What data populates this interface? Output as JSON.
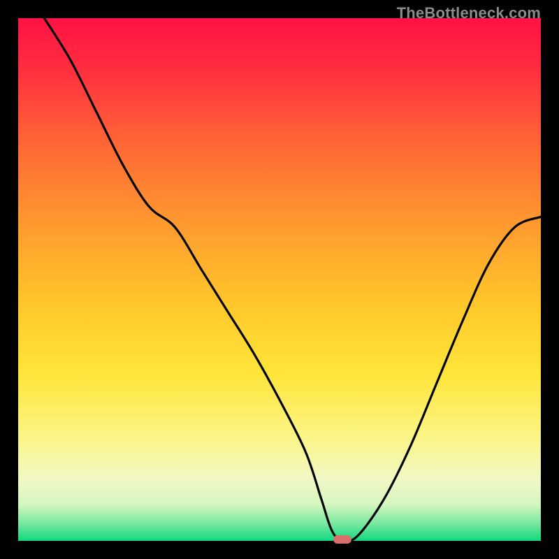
{
  "watermark": "TheBottleneck.com",
  "chart_data": {
    "type": "line",
    "title": "",
    "xlabel": "",
    "ylabel": "",
    "xlim": [
      0,
      100
    ],
    "ylim": [
      0,
      100
    ],
    "x": [
      5,
      10,
      15,
      20,
      25,
      30,
      35,
      40,
      45,
      50,
      55,
      58,
      60,
      62,
      65,
      70,
      75,
      80,
      85,
      90,
      95,
      100
    ],
    "values": [
      100,
      92,
      82,
      72,
      64,
      60,
      52,
      44,
      36,
      27,
      17,
      8,
      2,
      0,
      1,
      8,
      18,
      30,
      42,
      53,
      60,
      62
    ],
    "minimum_x": 62,
    "gradient_stops": [
      {
        "pos": 0.0,
        "color": "#ff1244"
      },
      {
        "pos": 0.1,
        "color": "#ff2f3f"
      },
      {
        "pos": 0.25,
        "color": "#ff6a35"
      },
      {
        "pos": 0.4,
        "color": "#ff9c2f"
      },
      {
        "pos": 0.55,
        "color": "#ffc82a"
      },
      {
        "pos": 0.68,
        "color": "#ffe53a"
      },
      {
        "pos": 0.8,
        "color": "#fbf585"
      },
      {
        "pos": 0.88,
        "color": "#f2f8c4"
      },
      {
        "pos": 0.93,
        "color": "#d6f6c0"
      },
      {
        "pos": 0.965,
        "color": "#7de9a2"
      },
      {
        "pos": 1.0,
        "color": "#12d880"
      }
    ],
    "marker": {
      "x": 62,
      "y": 0,
      "color": "#d86f6b"
    }
  }
}
